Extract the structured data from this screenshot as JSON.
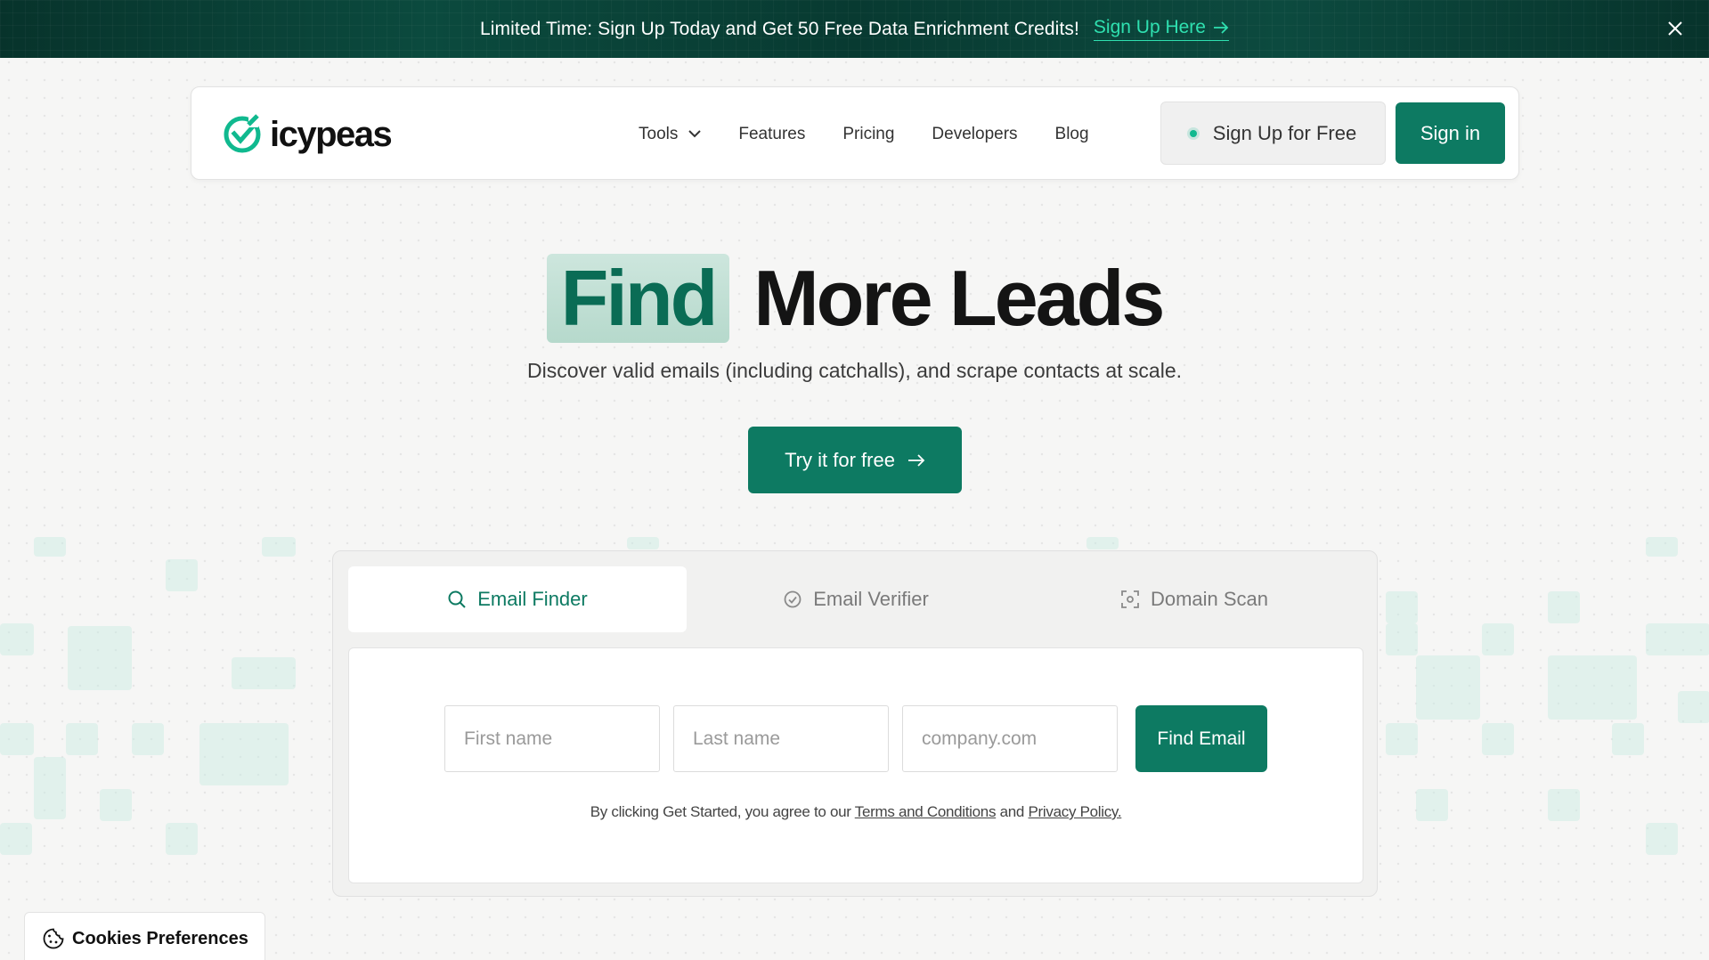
{
  "banner": {
    "text": "Limited Time: Sign Up Today and Get 50 Free Data Enrichment Credits!",
    "link_label": "Sign Up Here",
    "close_icon": "close-icon"
  },
  "nav": {
    "logo_text": "icypeas",
    "links": [
      "Tools",
      "Features",
      "Pricing",
      "Developers",
      "Blog"
    ],
    "signup_label": "Sign Up for Free",
    "signin_label": "Sign in"
  },
  "hero": {
    "highlight": "Find",
    "title_rest": "More Leads",
    "subtitle": "Discover valid emails (including catchalls), and scrape contacts at scale.",
    "cta_label": "Try it for free"
  },
  "tool_card": {
    "tabs": [
      {
        "label": "Email Finder",
        "icon": "search-icon",
        "active": true
      },
      {
        "label": "Email Verifier",
        "icon": "check-circle-icon",
        "active": false
      },
      {
        "label": "Domain Scan",
        "icon": "scan-icon",
        "active": false
      }
    ],
    "fields": {
      "first_name_placeholder": "First name",
      "last_name_placeholder": "Last name",
      "domain_placeholder": "company.com"
    },
    "submit_label": "Find Email",
    "terms_prefix": "By clicking Get Started, you agree to our",
    "terms_link": "Terms and Conditions",
    "terms_and": "and",
    "privacy_link": "Privacy Policy."
  },
  "cookies": {
    "label": "Cookies Preferences",
    "icon": "cookie-icon"
  },
  "colors": {
    "brand": "#0d7a62",
    "accent": "#2fe0b0",
    "banner_bg": "#07332b"
  }
}
